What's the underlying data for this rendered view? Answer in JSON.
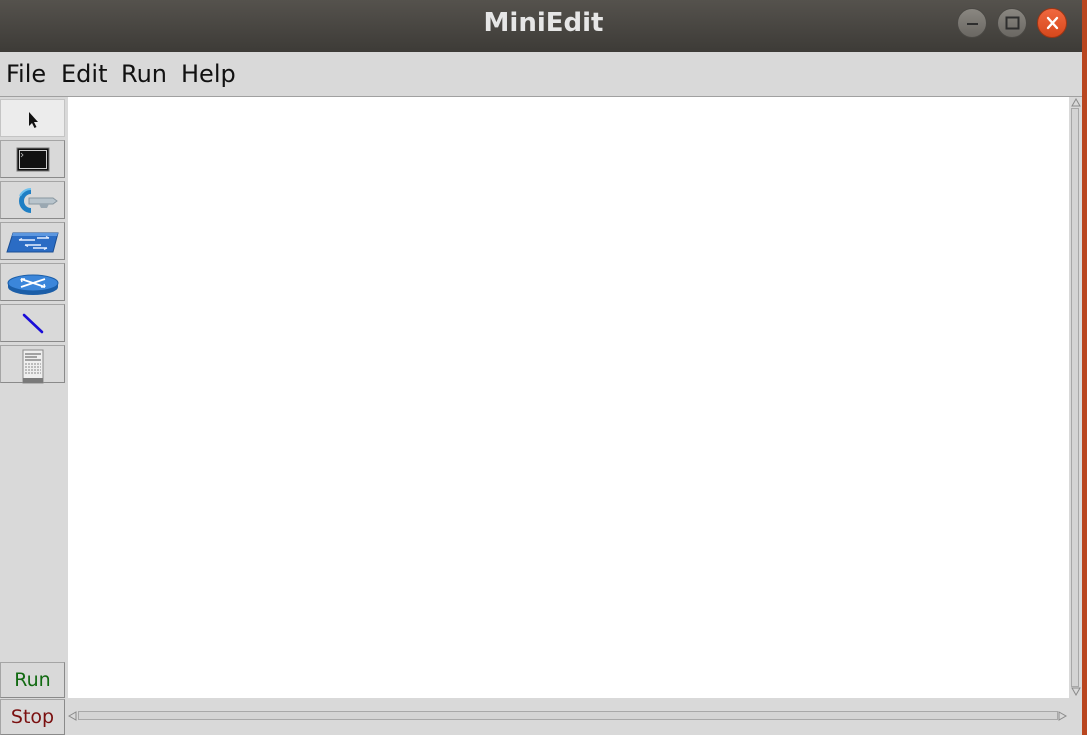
{
  "window": {
    "title": "MiniEdit",
    "controls": [
      "minimize-icon",
      "maximize-icon",
      "close-icon"
    ]
  },
  "menubar": {
    "items": [
      {
        "label": "File"
      },
      {
        "label": "Edit"
      },
      {
        "label": "Run"
      },
      {
        "label": "Help"
      }
    ]
  },
  "toolbar": {
    "tools": [
      {
        "icon": "select-cursor-icon",
        "active": true
      },
      {
        "icon": "host-terminal-icon"
      },
      {
        "icon": "controller-icon"
      },
      {
        "icon": "switch-icon"
      },
      {
        "icon": "router-icon"
      },
      {
        "icon": "link-line-icon"
      },
      {
        "icon": "server-icon"
      }
    ],
    "run_label": "Run",
    "stop_label": "Stop"
  },
  "colors": {
    "titlebar": "#3d3b37",
    "close_button": "#e0562a",
    "run_text": "#116a11",
    "stop_text": "#7a0f0f",
    "link_line": "#1a0dd8",
    "device_blue": "#2b6cc4"
  }
}
